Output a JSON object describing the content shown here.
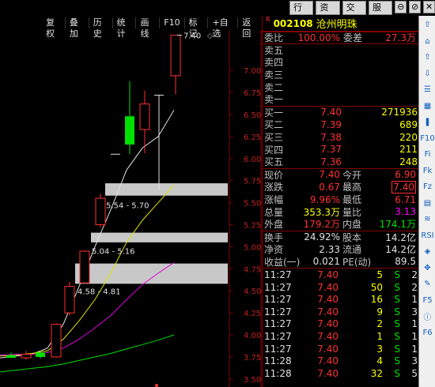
{
  "top_menu": [
    "行情",
    "资讯",
    "交易",
    "服务"
  ],
  "window_buttons": [
    "⊖",
    "⊘",
    "✕"
  ],
  "chart_toolbar": [
    "复权",
    "叠加",
    "历史",
    "统计",
    "画线",
    "F10",
    "标记",
    "+自选",
    "返回"
  ],
  "chart_data": {
    "type": "candlestick",
    "y_ticks": [
      "7.00",
      "6.75",
      "6.50",
      "6.25",
      "6.00",
      "5.75",
      "5.50",
      "5.25",
      "5.00",
      "4.75",
      "4.50",
      "4.25",
      "4.00",
      "3.75",
      "3.50"
    ],
    "ylim": [
      3.4,
      7.45
    ],
    "candles": [
      {
        "o": 3.77,
        "h": 3.8,
        "l": 3.74,
        "c": 3.74,
        "dir": "down"
      },
      {
        "o": 3.74,
        "h": 3.82,
        "l": 3.72,
        "c": 3.78,
        "dir": "up"
      },
      {
        "o": 3.8,
        "h": 3.82,
        "l": 3.73,
        "c": 3.75,
        "dir": "down"
      },
      {
        "o": 3.75,
        "h": 4.13,
        "l": 3.74,
        "c": 4.12,
        "dir": "up"
      },
      {
        "o": 4.25,
        "h": 4.6,
        "l": 4.22,
        "c": 4.55,
        "dir": "up"
      },
      {
        "o": 4.59,
        "h": 4.96,
        "l": 4.58,
        "c": 4.95,
        "dir": "up"
      },
      {
        "o": 5.25,
        "h": 5.6,
        "l": 5.22,
        "c": 5.55,
        "dir": "up"
      },
      {
        "o": 6.05,
        "h": 6.05,
        "l": 6.05,
        "c": 6.05,
        "dir": "flat"
      },
      {
        "o": 6.48,
        "h": 6.88,
        "l": 6.05,
        "c": 6.16,
        "dir": "down"
      },
      {
        "o": 6.33,
        "h": 6.77,
        "l": 6.06,
        "c": 6.62,
        "dir": "up"
      },
      {
        "o": 6.72,
        "h": 6.72,
        "l": 5.65,
        "c": 6.72,
        "dir": "flat"
      },
      {
        "o": 6.94,
        "h": 7.4,
        "l": 6.73,
        "c": 7.4,
        "dir": "up"
      }
    ],
    "annotations": [
      "7.40",
      "5.54 - 5.70",
      "5.04 - 5.16",
      "4.58 - 4.81"
    ],
    "gaps": [
      [
        5.58,
        5.72
      ],
      [
        5.05,
        5.16
      ],
      [
        4.58,
        4.81
      ]
    ],
    "ma_lines": [
      {
        "color": "#e0e0e0",
        "y": [
          3.74,
          3.76,
          3.78,
          3.85,
          4.12,
          4.55,
          5.0,
          5.42,
          5.87,
          6.12,
          6.25,
          6.55
        ]
      },
      {
        "color": "#e0e000",
        "y": [
          3.76,
          3.77,
          3.79,
          3.82,
          3.95,
          4.16,
          4.4,
          4.7,
          5.05,
          5.3,
          5.5,
          5.7
        ]
      },
      {
        "color": "#e000e0",
        "y": [
          3.77,
          3.78,
          3.78,
          3.8,
          3.85,
          3.95,
          4.08,
          4.22,
          4.4,
          4.57,
          4.7,
          4.82
        ]
      },
      {
        "color": "#00e000",
        "y": [
          3.58,
          3.6,
          3.62,
          3.64,
          3.67,
          3.71,
          3.75,
          3.79,
          3.84,
          3.89,
          3.94,
          4.0
        ]
      }
    ]
  },
  "quote": {
    "code": "002108",
    "name": "沧州明珠",
    "r_flag": "R",
    "weibi_label": "委比",
    "weibi": "100.00%",
    "weicha_label": "委差",
    "weicha": "27.3万",
    "sell": [
      {
        "label": "卖五",
        "price": "",
        "vol": ""
      },
      {
        "label": "卖四",
        "price": "",
        "vol": ""
      },
      {
        "label": "卖三",
        "price": "",
        "vol": ""
      },
      {
        "label": "卖二",
        "price": "",
        "vol": ""
      },
      {
        "label": "卖一",
        "price": "",
        "vol": ""
      }
    ],
    "buy": [
      {
        "label": "买一",
        "price": "7.40",
        "vol": "271936"
      },
      {
        "label": "买二",
        "price": "7.39",
        "vol": "689"
      },
      {
        "label": "买三",
        "price": "7.38",
        "vol": "220"
      },
      {
        "label": "买四",
        "price": "7.37",
        "vol": "211"
      },
      {
        "label": "买五",
        "price": "7.36",
        "vol": "248"
      }
    ],
    "stats1": [
      {
        "l1": "现价",
        "v1": "7.40",
        "c1": "red",
        "l2": "今开",
        "v2": "6.90",
        "c2": "red"
      },
      {
        "l1": "涨跌",
        "v1": "0.67",
        "c1": "red",
        "l2": "最高",
        "v2": "7.40",
        "c2": "redbox"
      },
      {
        "l1": "涨幅",
        "v1": "9.96%",
        "c1": "red",
        "l2": "最低",
        "v2": "6.71",
        "c2": "red"
      },
      {
        "l1": "总量",
        "v1": "353.3万",
        "c1": "yellow",
        "l2": "量比",
        "v2": "3.13",
        "c2": "magenta"
      },
      {
        "l1": "外盘",
        "v1": "179.2万",
        "c1": "red",
        "l2": "内盘",
        "v2": "174.1万",
        "c2": "green"
      }
    ],
    "stats2": [
      {
        "l1": "换手",
        "v1": "24.92%",
        "l2": "股本",
        "v2": "14.2亿"
      },
      {
        "l1": "净资",
        "v1": "2.33",
        "l2": "流通",
        "v2": "14.2亿"
      },
      {
        "l1": "收益(一)",
        "v1": "0.021",
        "l2": "PE(动)",
        "v2": "89.5"
      }
    ],
    "ticks": [
      {
        "t": "11:27",
        "p": "7.40",
        "v": "5",
        "s": "S",
        "n": "2"
      },
      {
        "t": "11:27",
        "p": "7.40",
        "v": "50",
        "s": "S",
        "n": "2"
      },
      {
        "t": "11:27",
        "p": "7.40",
        "v": "16",
        "s": "S",
        "n": "1"
      },
      {
        "t": "11:27",
        "p": "7.40",
        "v": "9",
        "s": "S",
        "n": "3"
      },
      {
        "t": "11:27",
        "p": "7.40",
        "v": "2",
        "s": "S",
        "n": "1"
      },
      {
        "t": "11:27",
        "p": "7.40",
        "v": "1",
        "s": "S",
        "n": "1"
      },
      {
        "t": "11:27",
        "p": "7.40",
        "v": "3",
        "s": "S",
        "n": "1"
      },
      {
        "t": "11:28",
        "p": "7.40",
        "v": "4",
        "s": "S",
        "n": "3"
      },
      {
        "t": "11:28",
        "p": "7.40",
        "v": "32",
        "s": "S",
        "n": "5"
      }
    ]
  },
  "sidebar_icons": [
    "chevron-up-icon",
    "home-icon",
    "page-up-icon",
    "page-down-icon",
    "list-icon",
    "grid-icon",
    "candle-icon",
    "f10-icon",
    "fi-icon",
    "fk-icon",
    "fz-icon",
    "layers-icon",
    "chart-icon",
    "rsi-icon",
    "compass-icon",
    "move-icon",
    "pencil-icon",
    "f5-icon",
    "info-icon",
    "f6-icon"
  ],
  "sidebar_text": [
    "⇧",
    "⌂",
    "⇧",
    "⇩",
    "☰",
    "▦",
    "❚",
    "F10",
    "Fi",
    "Fk",
    "Fz",
    "▤",
    "≋",
    "RSI",
    "◈",
    "✥",
    "✎",
    "F5",
    "ⓘ",
    "F6"
  ]
}
